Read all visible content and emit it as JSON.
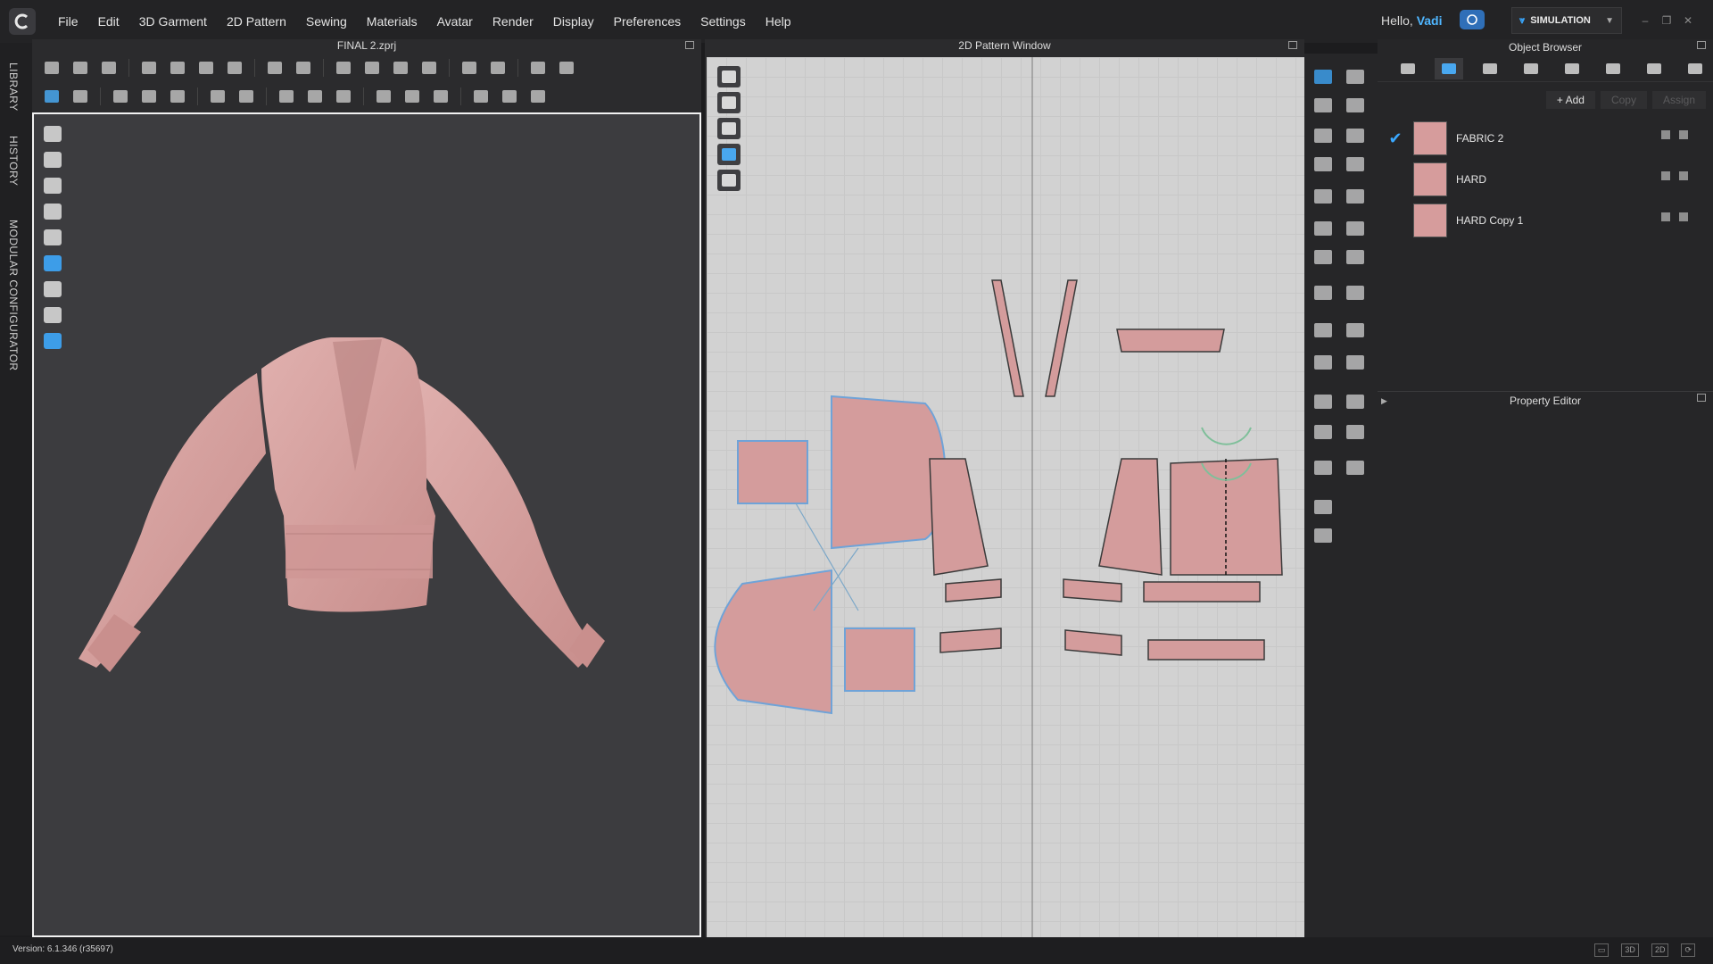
{
  "app": {
    "menu": [
      "File",
      "Edit",
      "3D Garment",
      "2D Pattern",
      "Sewing",
      "Materials",
      "Avatar",
      "Render",
      "Display",
      "Preferences",
      "Settings",
      "Help"
    ],
    "greeting": "Hello,",
    "user": "Vadi",
    "mode": "SIMULATION"
  },
  "sidebar": {
    "tabs": [
      "LIBRARY",
      "HISTORY",
      "MODULAR CONFIGURATOR"
    ]
  },
  "window3d": {
    "title": "FINAL 2.zprj"
  },
  "window2d": {
    "title": "2D Pattern Window"
  },
  "object_browser": {
    "title": "Object Browser",
    "add_label": "+ Add",
    "copy_label": "Copy",
    "assign_label": "Assign",
    "fabrics": [
      {
        "name": "FABRIC 2",
        "selected": true
      },
      {
        "name": "HARD",
        "selected": false
      },
      {
        "name": "HARD Copy 1",
        "selected": false
      }
    ],
    "swatch_color": "#d69c9c"
  },
  "property_editor": {
    "title": "Property Editor"
  },
  "status": {
    "version": "Version: 6.1.346 (r35697)",
    "view_modes": [
      "3D",
      "2D"
    ]
  },
  "colors": {
    "garment": "#d4a0a0",
    "pattern_fill": "#d49c9c",
    "pattern_outline": "#6fa3d8",
    "accent": "#3aa8ff"
  },
  "icons": {
    "check": "check-icon"
  }
}
